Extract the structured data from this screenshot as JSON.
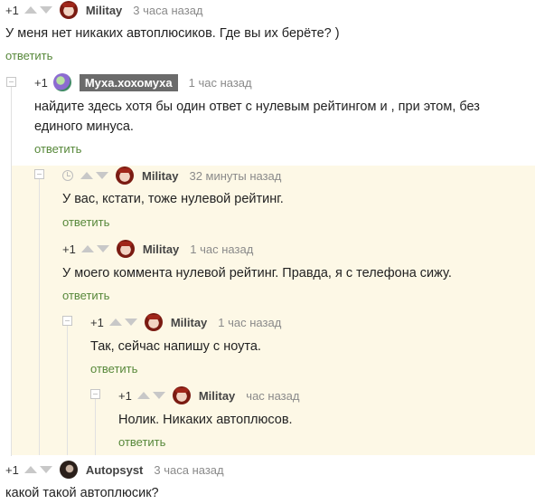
{
  "comments": [
    {
      "rating": "+1",
      "user": "Militay",
      "time": "3 часа назад",
      "text": "У меня нет никаких автоплюсиков. Где вы их берёте? )",
      "reply": "ответить"
    },
    {
      "rating": "+1",
      "user": "Муха.хохомуха",
      "time": "1 час назад",
      "text": "найдите здесь хотя бы один ответ с нулевым рейтингом и , при этом, без единого минуса.",
      "reply": "ответить"
    },
    {
      "rating": "",
      "user": "Militay",
      "time": "32 минуты назад",
      "text": "У вас, кстати, тоже нулевой рейтинг.",
      "reply": "ответить"
    },
    {
      "rating": "+1",
      "user": "Militay",
      "time": "1 час назад",
      "text": "У моего коммента нулевой рейтинг. Правда, я с телефона сижу.",
      "reply": "ответить"
    },
    {
      "rating": "+1",
      "user": "Militay",
      "time": "1 час назад",
      "text": "Так, сейчас напишу с ноута.",
      "reply": "ответить"
    },
    {
      "rating": "+1",
      "user": "Militay",
      "time": "час назад",
      "text": "Нолик. Никаких автоплюсов.",
      "reply": "ответить"
    },
    {
      "rating": "+1",
      "user": "Autopsyst",
      "time": "3 часа назад",
      "text": "какой такой автоплюсик?",
      "reply": ""
    }
  ],
  "icons": {
    "upvote": "arrow-up-icon",
    "downvote": "arrow-down-icon",
    "collapse": "collapse-icon",
    "pending": "clock-icon"
  },
  "colors": {
    "reply_link": "#57883a",
    "highlight_bg": "#fdf8e6",
    "username_highlight_bg": "#6b6b6b",
    "time": "#8a8a8a"
  }
}
